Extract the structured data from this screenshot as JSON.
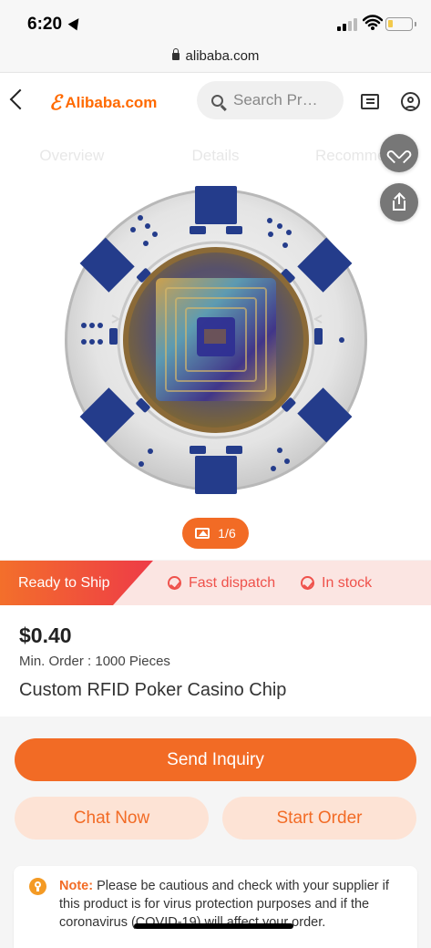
{
  "status": {
    "time": "6:20"
  },
  "browser": {
    "url": "alibaba.com"
  },
  "header": {
    "logo_mark": "ℰ",
    "logo_text": "Alibaba.com",
    "search_placeholder": "Search Pr…"
  },
  "tabs": [
    "Overview",
    "Details",
    "Recommend"
  ],
  "gallery": {
    "counter": "1/6"
  },
  "shipping": {
    "ready": "Ready to Ship",
    "fast": "Fast dispatch",
    "stock": "In stock"
  },
  "product": {
    "price": "$0.40",
    "moq": "Min. Order : 1000 Pieces",
    "title": "Custom RFID Poker Casino Chip"
  },
  "actions": {
    "send": "Send Inquiry",
    "chat": "Chat Now",
    "order": "Start Order"
  },
  "note": {
    "label": "Note:",
    "text": "Please be cautious and check with your supplier if this product is for virus protection purposes and if the coronavirus (COVID-19) will affect your order."
  },
  "colors": {
    "accent": "#f26b25",
    "chip_blue": "#243c8b",
    "notice_red": "#ef514b"
  },
  "icons": [
    "search-icon",
    "message-icon",
    "user-icon",
    "heart-icon",
    "share-icon",
    "image-icon",
    "check-circle-icon",
    "bulb-icon"
  ]
}
